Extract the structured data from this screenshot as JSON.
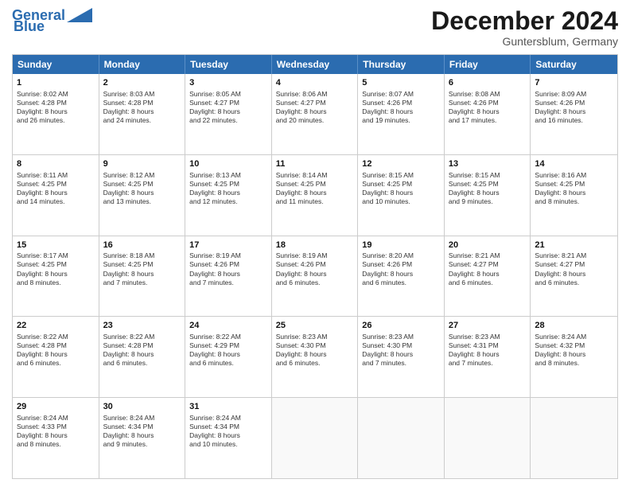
{
  "header": {
    "logo_line1": "General",
    "logo_line2": "Blue",
    "month": "December 2024",
    "location": "Guntersblum, Germany"
  },
  "weekdays": [
    "Sunday",
    "Monday",
    "Tuesday",
    "Wednesday",
    "Thursday",
    "Friday",
    "Saturday"
  ],
  "rows": [
    [
      {
        "day": "1",
        "info": "Sunrise: 8:02 AM\nSunset: 4:28 PM\nDaylight: 8 hours\nand 26 minutes."
      },
      {
        "day": "2",
        "info": "Sunrise: 8:03 AM\nSunset: 4:28 PM\nDaylight: 8 hours\nand 24 minutes."
      },
      {
        "day": "3",
        "info": "Sunrise: 8:05 AM\nSunset: 4:27 PM\nDaylight: 8 hours\nand 22 minutes."
      },
      {
        "day": "4",
        "info": "Sunrise: 8:06 AM\nSunset: 4:27 PM\nDaylight: 8 hours\nand 20 minutes."
      },
      {
        "day": "5",
        "info": "Sunrise: 8:07 AM\nSunset: 4:26 PM\nDaylight: 8 hours\nand 19 minutes."
      },
      {
        "day": "6",
        "info": "Sunrise: 8:08 AM\nSunset: 4:26 PM\nDaylight: 8 hours\nand 17 minutes."
      },
      {
        "day": "7",
        "info": "Sunrise: 8:09 AM\nSunset: 4:26 PM\nDaylight: 8 hours\nand 16 minutes."
      }
    ],
    [
      {
        "day": "8",
        "info": "Sunrise: 8:11 AM\nSunset: 4:25 PM\nDaylight: 8 hours\nand 14 minutes."
      },
      {
        "day": "9",
        "info": "Sunrise: 8:12 AM\nSunset: 4:25 PM\nDaylight: 8 hours\nand 13 minutes."
      },
      {
        "day": "10",
        "info": "Sunrise: 8:13 AM\nSunset: 4:25 PM\nDaylight: 8 hours\nand 12 minutes."
      },
      {
        "day": "11",
        "info": "Sunrise: 8:14 AM\nSunset: 4:25 PM\nDaylight: 8 hours\nand 11 minutes."
      },
      {
        "day": "12",
        "info": "Sunrise: 8:15 AM\nSunset: 4:25 PM\nDaylight: 8 hours\nand 10 minutes."
      },
      {
        "day": "13",
        "info": "Sunrise: 8:15 AM\nSunset: 4:25 PM\nDaylight: 8 hours\nand 9 minutes."
      },
      {
        "day": "14",
        "info": "Sunrise: 8:16 AM\nSunset: 4:25 PM\nDaylight: 8 hours\nand 8 minutes."
      }
    ],
    [
      {
        "day": "15",
        "info": "Sunrise: 8:17 AM\nSunset: 4:25 PM\nDaylight: 8 hours\nand 8 minutes."
      },
      {
        "day": "16",
        "info": "Sunrise: 8:18 AM\nSunset: 4:25 PM\nDaylight: 8 hours\nand 7 minutes."
      },
      {
        "day": "17",
        "info": "Sunrise: 8:19 AM\nSunset: 4:26 PM\nDaylight: 8 hours\nand 7 minutes."
      },
      {
        "day": "18",
        "info": "Sunrise: 8:19 AM\nSunset: 4:26 PM\nDaylight: 8 hours\nand 6 minutes."
      },
      {
        "day": "19",
        "info": "Sunrise: 8:20 AM\nSunset: 4:26 PM\nDaylight: 8 hours\nand 6 minutes."
      },
      {
        "day": "20",
        "info": "Sunrise: 8:21 AM\nSunset: 4:27 PM\nDaylight: 8 hours\nand 6 minutes."
      },
      {
        "day": "21",
        "info": "Sunrise: 8:21 AM\nSunset: 4:27 PM\nDaylight: 8 hours\nand 6 minutes."
      }
    ],
    [
      {
        "day": "22",
        "info": "Sunrise: 8:22 AM\nSunset: 4:28 PM\nDaylight: 8 hours\nand 6 minutes."
      },
      {
        "day": "23",
        "info": "Sunrise: 8:22 AM\nSunset: 4:28 PM\nDaylight: 8 hours\nand 6 minutes."
      },
      {
        "day": "24",
        "info": "Sunrise: 8:22 AM\nSunset: 4:29 PM\nDaylight: 8 hours\nand 6 minutes."
      },
      {
        "day": "25",
        "info": "Sunrise: 8:23 AM\nSunset: 4:30 PM\nDaylight: 8 hours\nand 6 minutes."
      },
      {
        "day": "26",
        "info": "Sunrise: 8:23 AM\nSunset: 4:30 PM\nDaylight: 8 hours\nand 7 minutes."
      },
      {
        "day": "27",
        "info": "Sunrise: 8:23 AM\nSunset: 4:31 PM\nDaylight: 8 hours\nand 7 minutes."
      },
      {
        "day": "28",
        "info": "Sunrise: 8:24 AM\nSunset: 4:32 PM\nDaylight: 8 hours\nand 8 minutes."
      }
    ],
    [
      {
        "day": "29",
        "info": "Sunrise: 8:24 AM\nSunset: 4:33 PM\nDaylight: 8 hours\nand 8 minutes."
      },
      {
        "day": "30",
        "info": "Sunrise: 8:24 AM\nSunset: 4:34 PM\nDaylight: 8 hours\nand 9 minutes."
      },
      {
        "day": "31",
        "info": "Sunrise: 8:24 AM\nSunset: 4:34 PM\nDaylight: 8 hours\nand 10 minutes."
      },
      {
        "day": "",
        "info": ""
      },
      {
        "day": "",
        "info": ""
      },
      {
        "day": "",
        "info": ""
      },
      {
        "day": "",
        "info": ""
      }
    ]
  ]
}
